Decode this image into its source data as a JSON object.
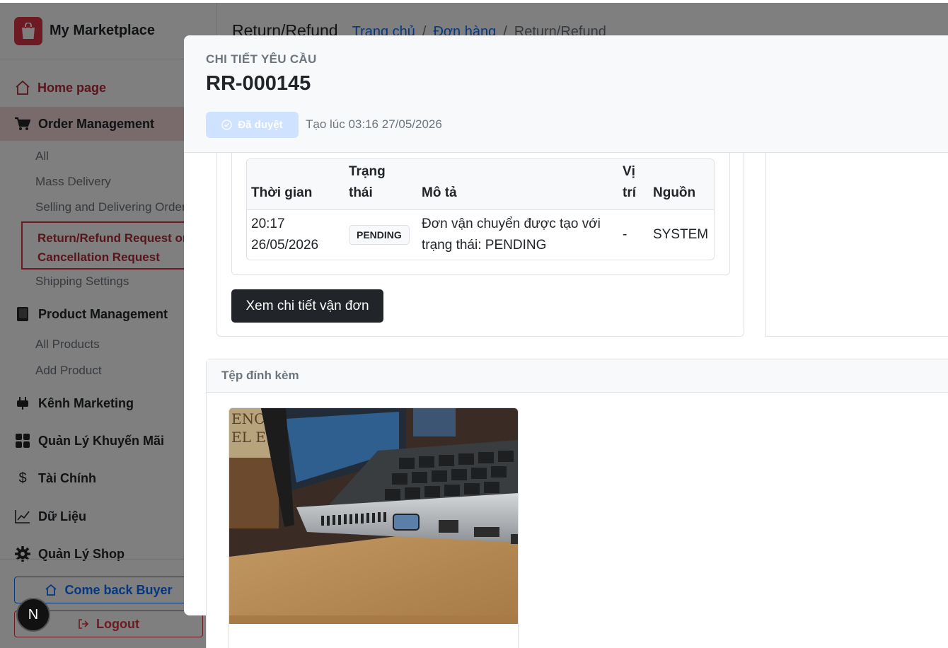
{
  "brand": {
    "name": "My Marketplace"
  },
  "sidebar": {
    "home_label": "Home page",
    "order_group": "Order Management",
    "order_items": [
      "All",
      "Mass Delivery",
      "Selling and Delivering Orders"
    ],
    "order_active_line1": "Return/Refund Request or",
    "order_active_line2": "Cancellation Request",
    "shipping_settings": "Shipping Settings",
    "product_group": "Product Management",
    "product_items": [
      "All Products",
      "Add Product"
    ],
    "marketing": "Kênh Marketing",
    "promotions": "Quản Lý Khuyến Mãi",
    "finance": "Tài Chính",
    "data": "Dữ Liệu",
    "shop": "Quản Lý Shop",
    "buyer_button": "Come back Buyer",
    "logout_button": "Logout"
  },
  "header": {
    "title": "Return/Refund",
    "breadcrumb": [
      "Trang chủ",
      "Đơn hàng",
      "Return/Refund"
    ]
  },
  "modal": {
    "kicker": "CHI TIẾT YÊU CẦU",
    "code": "RR-000145",
    "status": "Đã duyệt",
    "created": "Tạo lúc 03:16 27/05/2026",
    "tracking": {
      "headers": {
        "time_1": "Thời gian",
        "status_1": "Trạng",
        "status_2": "thái",
        "desc": "Mô tả",
        "loc_1": "Vị",
        "loc_2": "trí",
        "source": "Nguồn"
      },
      "rows": [
        {
          "time_1": "20:17",
          "time_2": "26/05/2026",
          "status": "PENDING",
          "desc_1": "Đơn vận chuyển được tạo với",
          "desc_2": "trạng thái: PENDING",
          "location": "-",
          "source": "SYSTEM"
        }
      ]
    },
    "waybill_button": "Xem chi tiết vận đơn",
    "attachments_title": "Tệp đính kèm"
  },
  "next_badge": "N",
  "colors": {
    "brand": "#dc3545",
    "link": "#0d6efd",
    "dark": "#212529"
  }
}
